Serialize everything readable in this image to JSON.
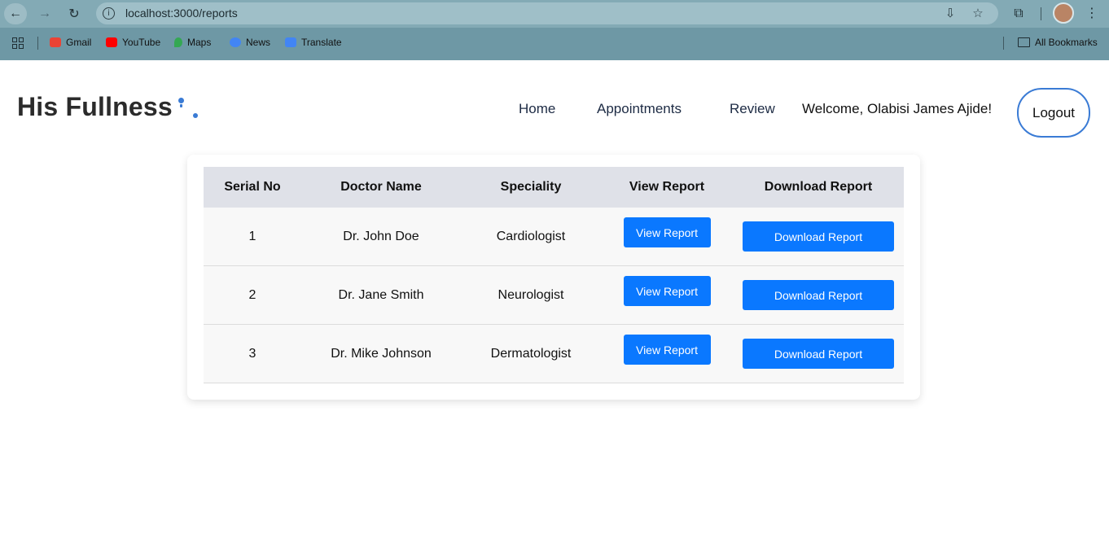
{
  "browser": {
    "url": "localhost:3000/reports",
    "bookmarks": [
      {
        "label": "Gmail",
        "color": "#ea4335"
      },
      {
        "label": "YouTube",
        "color": "#ff0000"
      },
      {
        "label": "Maps",
        "color": "#34a853"
      },
      {
        "label": "News",
        "color": "#4285f4"
      },
      {
        "label": "Translate",
        "color": "#4285f4"
      }
    ],
    "all_bookmarks": "All Bookmarks"
  },
  "header": {
    "brand": "His Fullness",
    "nav": [
      "Home",
      "Appointments",
      "Review"
    ],
    "welcome": "Welcome, Olabisi James Ajide!",
    "logout": "Logout",
    "accent": "#3a7bd5"
  },
  "table": {
    "headers": [
      "Serial No",
      "Doctor Name",
      "Speciality",
      "View Report",
      "Download Report"
    ],
    "rows": [
      {
        "serial": "1",
        "doctor": "Dr. John Doe",
        "speciality": "Cardiologist",
        "view": "View Report",
        "download": "Download Report"
      },
      {
        "serial": "2",
        "doctor": "Dr. Jane Smith",
        "speciality": "Neurologist",
        "view": "View Report",
        "download": "Download Report"
      },
      {
        "serial": "3",
        "doctor": "Dr. Mike Johnson",
        "speciality": "Dermatologist",
        "view": "View Report",
        "download": "Download Report"
      }
    ],
    "button_color": "#0a78ff"
  }
}
